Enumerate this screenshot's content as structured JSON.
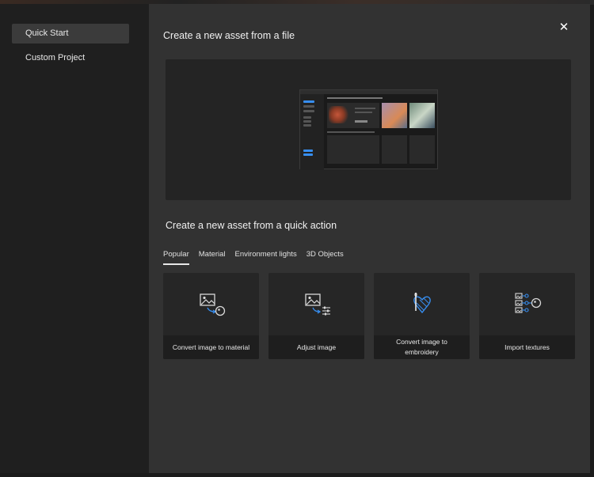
{
  "sidebar": {
    "items": [
      {
        "label": "Quick Start",
        "active": true
      },
      {
        "label": "Custom Project",
        "active": false
      }
    ]
  },
  "main": {
    "close_icon": "close-icon",
    "file_heading": "Create a new asset from a file",
    "quick_action_heading": "Create a new asset from a quick action",
    "tabs": [
      {
        "label": "Popular",
        "active": true
      },
      {
        "label": "Material",
        "active": false
      },
      {
        "label": "Environment lights",
        "active": false
      },
      {
        "label": "3D Objects",
        "active": false
      }
    ],
    "cards": [
      {
        "label": "Convert image to material",
        "icon": "image-to-material-icon"
      },
      {
        "label": "Adjust image",
        "icon": "adjust-image-icon"
      },
      {
        "label": "Convert image to embroidery",
        "icon": "embroidery-icon"
      },
      {
        "label": "Import textures",
        "icon": "import-textures-icon"
      }
    ]
  },
  "colors": {
    "accent_blue": "#378ef0",
    "dialog_bg": "#323232",
    "sidebar_bg": "#1f1f1f"
  }
}
